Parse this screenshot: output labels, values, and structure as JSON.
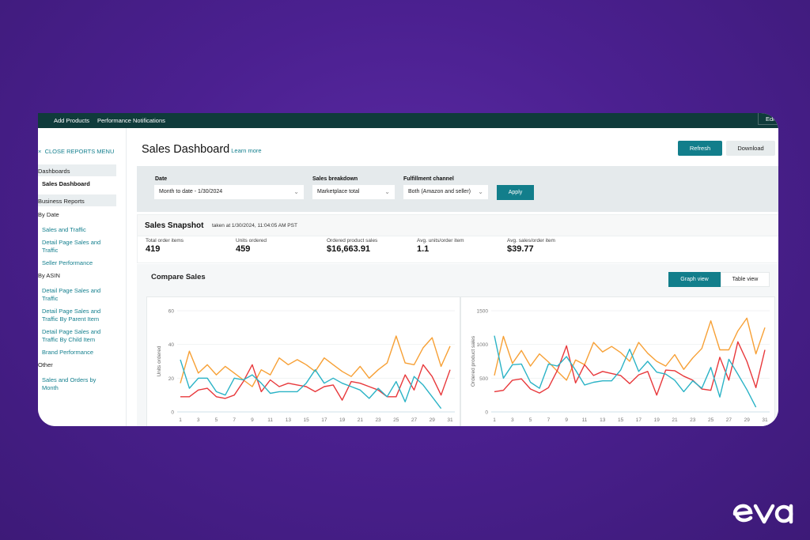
{
  "topnav": {
    "items": [
      "Add Products",
      "Performance Notifications"
    ],
    "edit_label": "Edi"
  },
  "sidebar": {
    "close_menu": "CLOSE REPORTS MENU",
    "sections": [
      {
        "label": "Dashboards"
      },
      {
        "label": "Business Reports"
      }
    ],
    "active_item": "Sales Dashboard",
    "groups": [
      {
        "label": "By Date",
        "links": [
          "Sales and Traffic",
          "Detail Page Sales and Traffic",
          "Seller Performance"
        ]
      },
      {
        "label": "By ASIN",
        "links": [
          "Detail Page Sales and Traffic",
          "Detail Page Sales and Traffic By Parent Item",
          "Detail Page Sales and Traffic By Child Item",
          "Brand Performance"
        ]
      },
      {
        "label": "Other",
        "links": [
          "Sales and Orders by Month"
        ]
      }
    ]
  },
  "header": {
    "title": "Sales Dashboard",
    "learn_more": "Learn more",
    "refresh": "Refresh",
    "download": "Download"
  },
  "filters": {
    "date": {
      "label": "Date",
      "value": "Month to date - 1/30/2024"
    },
    "breakdown": {
      "label": "Sales breakdown",
      "value": "Marketplace total"
    },
    "fulfillment": {
      "label": "Fulfillment channel",
      "value": "Both (Amazon and seller)"
    },
    "apply": "Apply"
  },
  "snapshot": {
    "title": "Sales Snapshot",
    "taken_at": "taken at 1/30/2024, 11:04:05 AM PST",
    "metrics": [
      {
        "label": "Total order items",
        "value": "419"
      },
      {
        "label": "Units ordered",
        "value": "459"
      },
      {
        "label": "Ordered product sales",
        "value": "$16,663.91"
      },
      {
        "label": "Avg. units/order item",
        "value": "1.1"
      },
      {
        "label": "Avg. sales/order item",
        "value": "$39.77"
      }
    ]
  },
  "compare": {
    "title": "Compare Sales",
    "graph_view": "Graph view",
    "table_view": "Table view"
  },
  "colors": {
    "accent": "#127e8b",
    "orange": "#f7a035",
    "red": "#e8383b",
    "teal": "#2bb3c6"
  },
  "chart_data": [
    {
      "type": "line",
      "ylabel": "Units ordered",
      "xlabel": "",
      "ylim": [
        0,
        60
      ],
      "yticks": [
        0,
        20,
        40,
        60
      ],
      "xticks": [
        1,
        3,
        5,
        7,
        9,
        11,
        13,
        15,
        17,
        19,
        21,
        23,
        25,
        27,
        29,
        31
      ],
      "x": [
        1,
        2,
        3,
        4,
        5,
        6,
        7,
        8,
        9,
        10,
        11,
        12,
        13,
        14,
        15,
        16,
        17,
        18,
        19,
        20,
        21,
        22,
        23,
        24,
        25,
        26,
        27,
        28,
        29,
        30,
        31
      ],
      "series": [
        {
          "name": "orange",
          "color": "#f7a035",
          "values": [
            17,
            36,
            23,
            28,
            22,
            27,
            23,
            19,
            15,
            25,
            22,
            32,
            28,
            31,
            28,
            24,
            32,
            28,
            24,
            21,
            27,
            20,
            25,
            29,
            45,
            29,
            28,
            38,
            44,
            27,
            39
          ]
        },
        {
          "name": "red",
          "color": "#e8383b",
          "values": [
            9,
            9,
            13,
            14,
            9,
            8,
            10,
            18,
            28,
            12,
            19,
            15,
            17,
            16,
            15,
            12,
            15,
            16,
            7,
            18,
            17,
            15,
            13,
            9,
            9,
            22,
            13,
            28,
            21,
            10,
            25
          ]
        },
        {
          "name": "teal",
          "color": "#2bb3c6",
          "values": [
            31,
            14,
            20,
            20,
            12,
            10,
            20,
            19,
            22,
            17,
            11,
            12,
            12,
            12,
            17,
            25,
            17,
            20,
            17,
            15,
            13,
            8,
            14,
            9,
            18,
            6,
            21,
            16,
            9,
            2,
            null
          ]
        }
      ]
    },
    {
      "type": "line",
      "ylabel": "Ordered product sales",
      "xlabel": "",
      "ylim": [
        0,
        1500
      ],
      "yticks": [
        0,
        500,
        1000,
        1500
      ],
      "xticks": [
        1,
        3,
        5,
        7,
        9,
        11,
        13,
        15,
        17,
        19,
        21,
        23,
        25,
        27,
        29,
        31
      ],
      "x": [
        1,
        2,
        3,
        4,
        5,
        6,
        7,
        8,
        9,
        10,
        11,
        12,
        13,
        14,
        15,
        16,
        17,
        18,
        19,
        20,
        21,
        22,
        23,
        24,
        25,
        26,
        27,
        28,
        29,
        30,
        31
      ],
      "series": [
        {
          "name": "orange",
          "color": "#f7a035",
          "values": [
            540,
            1120,
            720,
            910,
            680,
            860,
            740,
            600,
            470,
            770,
            700,
            1030,
            890,
            970,
            880,
            750,
            1030,
            870,
            750,
            680,
            850,
            630,
            800,
            940,
            1350,
            920,
            920,
            1200,
            1390,
            860,
            1250
          ]
        },
        {
          "name": "red",
          "color": "#e8383b",
          "values": [
            300,
            320,
            470,
            490,
            340,
            280,
            360,
            620,
            980,
            430,
            700,
            540,
            600,
            570,
            540,
            420,
            550,
            600,
            250,
            620,
            610,
            530,
            470,
            340,
            320,
            810,
            470,
            1040,
            750,
            360,
            920
          ]
        },
        {
          "name": "teal",
          "color": "#2bb3c6",
          "values": [
            1130,
            500,
            700,
            710,
            440,
            350,
            710,
            680,
            820,
            620,
            400,
            440,
            460,
            460,
            620,
            930,
            600,
            750,
            590,
            560,
            470,
            300,
            460,
            350,
            660,
            220,
            780,
            560,
            330,
            70,
            null
          ]
        }
      ]
    }
  ]
}
